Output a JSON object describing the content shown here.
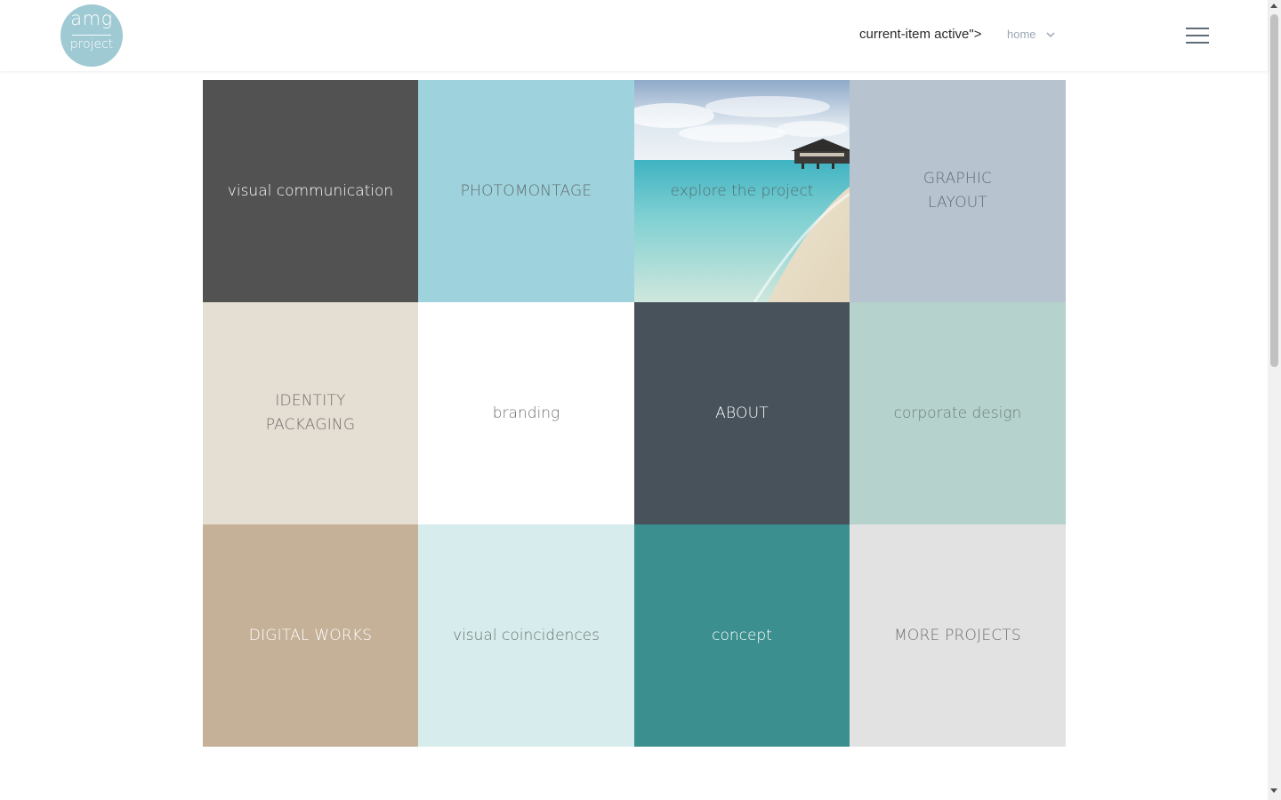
{
  "logo": {
    "line1": "amg",
    "line2": "project",
    "color": "#9fcad3"
  },
  "nav": {
    "active_label": "current-item active\">",
    "home_label": "home"
  },
  "tiles": [
    {
      "label": "visual communication",
      "bg": "#525252",
      "fg": "#ffffff"
    },
    {
      "label": "PHOTOMONTAGE",
      "bg": "#9ed2dc",
      "fg": "#5f6b6e"
    },
    {
      "label": "explore the project",
      "bg": "#bfe0e6",
      "fg": "#556b70",
      "image": "beach-photo"
    },
    {
      "label": "GRAPHIC\nLAYOUT",
      "bg": "#b7c3cf",
      "fg": "#5f6b78"
    },
    {
      "label": "IDENTITY\nPACKAGING",
      "bg": "#e5ded2",
      "fg": "#6e6e6e"
    },
    {
      "label": "branding",
      "bg": "#ffffff",
      "fg": "#6e6e6e"
    },
    {
      "label": "ABOUT",
      "bg": "#47525b",
      "fg": "#ffffff"
    },
    {
      "label": "corporate design",
      "bg": "#b5d2cc",
      "fg": "#6b7a78"
    },
    {
      "label": "DIGITAL WORKS",
      "bg": "#c5b098",
      "fg": "#ffffff"
    },
    {
      "label": "visual coincidences",
      "bg": "#d7ecec",
      "fg": "#6b7373"
    },
    {
      "label": "concept",
      "bg": "#3b8f8f",
      "fg": "#ffffff"
    },
    {
      "label": "MORE PROJECTS",
      "bg": "#e2e2e2",
      "fg": "#6e6e6e"
    }
  ]
}
